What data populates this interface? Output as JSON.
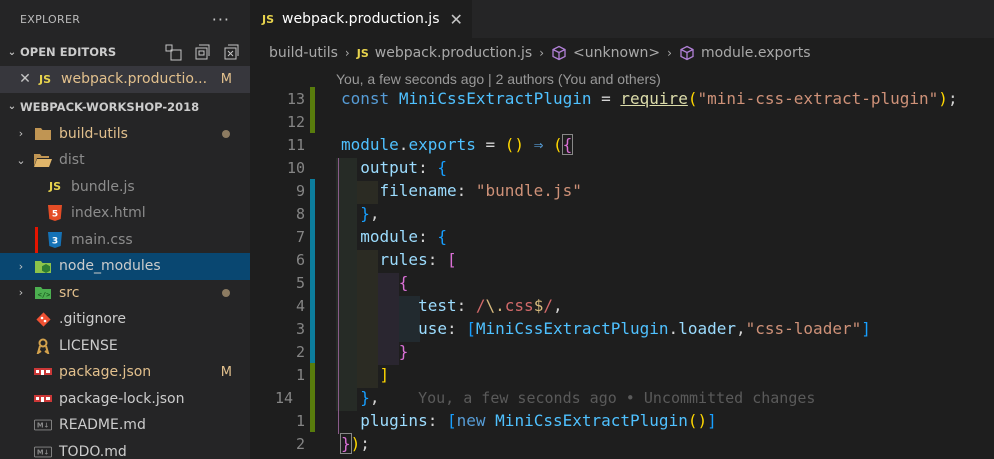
{
  "explorer": {
    "title": "EXPLORER",
    "more": "···",
    "open_editors": {
      "label": "OPEN EDITORS",
      "items": [
        {
          "icon": "JS",
          "name": "webpack.productio...",
          "badge": "M"
        }
      ]
    },
    "workspace": {
      "label": "WEBPACK-WORKSHOP-2018",
      "items": [
        {
          "name": "build-utils",
          "badge": ""
        },
        {
          "name": "dist",
          "badge": ""
        },
        {
          "name": "bundle.js",
          "icon": "JS"
        },
        {
          "name": "index.html",
          "icon": "5"
        },
        {
          "name": "main.css",
          "icon": "3"
        },
        {
          "name": "node_modules"
        },
        {
          "name": "src"
        },
        {
          "name": ".gitignore"
        },
        {
          "name": "LICENSE"
        },
        {
          "name": "package.json",
          "badge": "M"
        },
        {
          "name": "package-lock.json"
        },
        {
          "name": "README.md",
          "icon": "M↓"
        },
        {
          "name": "TODO.md",
          "icon": "M↓"
        }
      ]
    }
  },
  "tab": {
    "icon": "JS",
    "label": "webpack.production.js",
    "close": "✕"
  },
  "breadcrumbs": [
    "build-utils",
    "webpack.production.js",
    "<unknown>",
    "module.exports"
  ],
  "codelens": "You, a few seconds ago | 2 authors (You and others)",
  "line_numbers": [
    "13",
    "12",
    "11",
    "10",
    "9",
    "8",
    "7",
    "6",
    "5",
    "4",
    "3",
    "2",
    "1",
    "14",
    "1",
    "2"
  ],
  "code": {
    "l1": [
      "const",
      "MiniCssExtractPlugin",
      "=",
      "require",
      "(",
      "\"mini-css-extract-plugin\"",
      ")",
      ";"
    ],
    "l3": [
      "module",
      ".",
      "exports",
      "=",
      "()",
      "⇒",
      "(",
      "{"
    ],
    "l4": [
      "output",
      ":",
      "{"
    ],
    "l5": [
      "filename",
      ":",
      "\"bundle.js\""
    ],
    "l6": [
      "}",
      ","
    ],
    "l7": [
      "module",
      ":",
      "{"
    ],
    "l8": [
      "rules",
      ":",
      "["
    ],
    "l9": [
      "{"
    ],
    "l10": [
      "test",
      ":",
      "/",
      "\\.",
      "css",
      "$",
      "/",
      ","
    ],
    "l11": [
      "use",
      ":",
      "[",
      "MiniCssExtractPlugin",
      ".",
      "loader",
      ",",
      "\"css-loader\"",
      "]"
    ],
    "l12": [
      "}"
    ],
    "l13": [
      "]"
    ],
    "l14": [
      "}",
      ","
    ],
    "l14_ghost": "You, a few seconds ago • Uncommitted changes",
    "l15": [
      "plugins",
      ":",
      "[",
      "new",
      "MiniCssExtractPlugin",
      "()",
      "]"
    ],
    "l16": [
      "}",
      ")",
      ";"
    ]
  },
  "colors": {
    "accent_selection": "#094771",
    "git_added": "#587c0c",
    "git_modified": "#0c7d9d",
    "git_deleted": "#94151b",
    "modified_badge": "#e2c08d"
  }
}
